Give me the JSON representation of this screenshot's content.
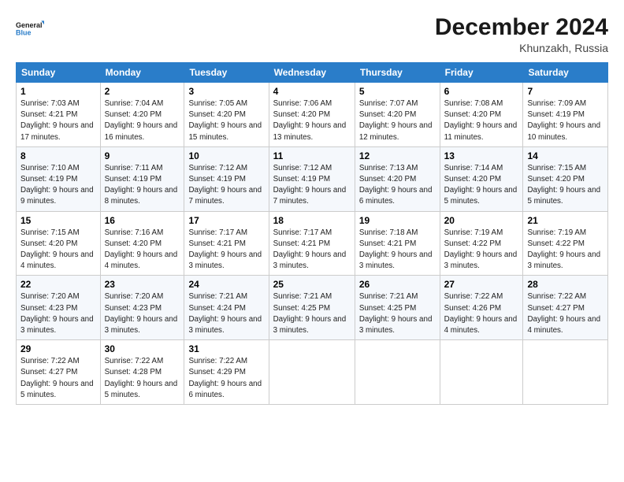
{
  "logo": {
    "line1": "General",
    "line2": "Blue"
  },
  "title": "December 2024",
  "subtitle": "Khunzakh, Russia",
  "header_days": [
    "Sunday",
    "Monday",
    "Tuesday",
    "Wednesday",
    "Thursday",
    "Friday",
    "Saturday"
  ],
  "weeks": [
    [
      {
        "num": "1",
        "sunrise": "7:03 AM",
        "sunset": "4:21 PM",
        "daylight": "9 hours and 17 minutes."
      },
      {
        "num": "2",
        "sunrise": "7:04 AM",
        "sunset": "4:20 PM",
        "daylight": "9 hours and 16 minutes."
      },
      {
        "num": "3",
        "sunrise": "7:05 AM",
        "sunset": "4:20 PM",
        "daylight": "9 hours and 15 minutes."
      },
      {
        "num": "4",
        "sunrise": "7:06 AM",
        "sunset": "4:20 PM",
        "daylight": "9 hours and 13 minutes."
      },
      {
        "num": "5",
        "sunrise": "7:07 AM",
        "sunset": "4:20 PM",
        "daylight": "9 hours and 12 minutes."
      },
      {
        "num": "6",
        "sunrise": "7:08 AM",
        "sunset": "4:20 PM",
        "daylight": "9 hours and 11 minutes."
      },
      {
        "num": "7",
        "sunrise": "7:09 AM",
        "sunset": "4:19 PM",
        "daylight": "9 hours and 10 minutes."
      }
    ],
    [
      {
        "num": "8",
        "sunrise": "7:10 AM",
        "sunset": "4:19 PM",
        "daylight": "9 hours and 9 minutes."
      },
      {
        "num": "9",
        "sunrise": "7:11 AM",
        "sunset": "4:19 PM",
        "daylight": "9 hours and 8 minutes."
      },
      {
        "num": "10",
        "sunrise": "7:12 AM",
        "sunset": "4:19 PM",
        "daylight": "9 hours and 7 minutes."
      },
      {
        "num": "11",
        "sunrise": "7:12 AM",
        "sunset": "4:19 PM",
        "daylight": "9 hours and 7 minutes."
      },
      {
        "num": "12",
        "sunrise": "7:13 AM",
        "sunset": "4:20 PM",
        "daylight": "9 hours and 6 minutes."
      },
      {
        "num": "13",
        "sunrise": "7:14 AM",
        "sunset": "4:20 PM",
        "daylight": "9 hours and 5 minutes."
      },
      {
        "num": "14",
        "sunrise": "7:15 AM",
        "sunset": "4:20 PM",
        "daylight": "9 hours and 5 minutes."
      }
    ],
    [
      {
        "num": "15",
        "sunrise": "7:15 AM",
        "sunset": "4:20 PM",
        "daylight": "9 hours and 4 minutes."
      },
      {
        "num": "16",
        "sunrise": "7:16 AM",
        "sunset": "4:20 PM",
        "daylight": "9 hours and 4 minutes."
      },
      {
        "num": "17",
        "sunrise": "7:17 AM",
        "sunset": "4:21 PM",
        "daylight": "9 hours and 3 minutes."
      },
      {
        "num": "18",
        "sunrise": "7:17 AM",
        "sunset": "4:21 PM",
        "daylight": "9 hours and 3 minutes."
      },
      {
        "num": "19",
        "sunrise": "7:18 AM",
        "sunset": "4:21 PM",
        "daylight": "9 hours and 3 minutes."
      },
      {
        "num": "20",
        "sunrise": "7:19 AM",
        "sunset": "4:22 PM",
        "daylight": "9 hours and 3 minutes."
      },
      {
        "num": "21",
        "sunrise": "7:19 AM",
        "sunset": "4:22 PM",
        "daylight": "9 hours and 3 minutes."
      }
    ],
    [
      {
        "num": "22",
        "sunrise": "7:20 AM",
        "sunset": "4:23 PM",
        "daylight": "9 hours and 3 minutes."
      },
      {
        "num": "23",
        "sunrise": "7:20 AM",
        "sunset": "4:23 PM",
        "daylight": "9 hours and 3 minutes."
      },
      {
        "num": "24",
        "sunrise": "7:21 AM",
        "sunset": "4:24 PM",
        "daylight": "9 hours and 3 minutes."
      },
      {
        "num": "25",
        "sunrise": "7:21 AM",
        "sunset": "4:25 PM",
        "daylight": "9 hours and 3 minutes."
      },
      {
        "num": "26",
        "sunrise": "7:21 AM",
        "sunset": "4:25 PM",
        "daylight": "9 hours and 3 minutes."
      },
      {
        "num": "27",
        "sunrise": "7:22 AM",
        "sunset": "4:26 PM",
        "daylight": "9 hours and 4 minutes."
      },
      {
        "num": "28",
        "sunrise": "7:22 AM",
        "sunset": "4:27 PM",
        "daylight": "9 hours and 4 minutes."
      }
    ],
    [
      {
        "num": "29",
        "sunrise": "7:22 AM",
        "sunset": "4:27 PM",
        "daylight": "9 hours and 5 minutes."
      },
      {
        "num": "30",
        "sunrise": "7:22 AM",
        "sunset": "4:28 PM",
        "daylight": "9 hours and 5 minutes."
      },
      {
        "num": "31",
        "sunrise": "7:22 AM",
        "sunset": "4:29 PM",
        "daylight": "9 hours and 6 minutes."
      },
      null,
      null,
      null,
      null
    ]
  ]
}
